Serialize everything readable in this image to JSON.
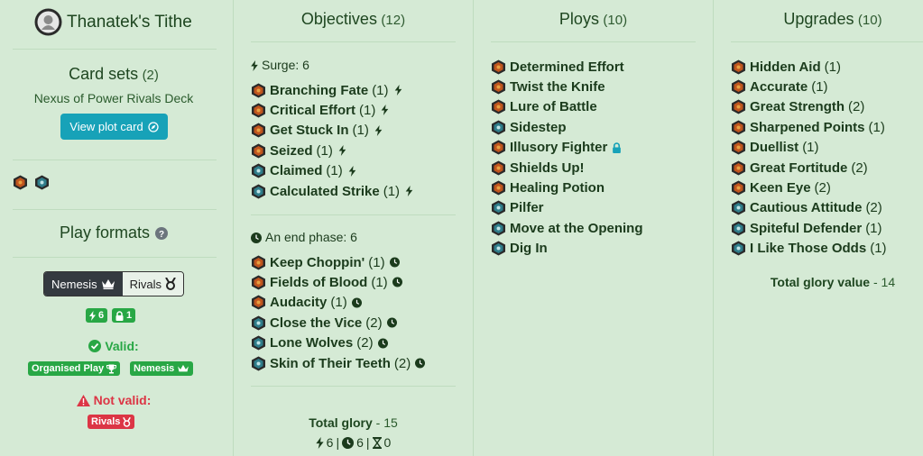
{
  "deck": {
    "title": "Thanatek's Tithe",
    "card_sets_label": "Card sets",
    "card_sets_count": "(2)",
    "card_set_name": "Nexus of Power Rivals Deck",
    "view_plot_label": "View plot card",
    "play_formats_label": "Play formats",
    "formats": {
      "nemesis": "Nemesis",
      "rivals": "Rivals",
      "selected": "Nemesis"
    },
    "stats": {
      "surge": "6",
      "locked": "1"
    },
    "valid_label": "Valid:",
    "valid_badges": [
      "Organised Play",
      "Nemesis"
    ],
    "not_valid_label": "Not valid:",
    "not_valid_badges": [
      "Rivals"
    ]
  },
  "objectives": {
    "title": "Objectives",
    "count": "(12)",
    "surge_label": "Surge: 6",
    "end_phase_label": "An end phase: 6",
    "surge_cards": [
      {
        "name": "Branching Fate",
        "qty": "(1)",
        "faction": "orange"
      },
      {
        "name": "Critical Effort",
        "qty": "(1)",
        "faction": "orange"
      },
      {
        "name": "Get Stuck In",
        "qty": "(1)",
        "faction": "orange"
      },
      {
        "name": "Seized",
        "qty": "(1)",
        "faction": "orange"
      },
      {
        "name": "Claimed",
        "qty": "(1)",
        "faction": "teal"
      },
      {
        "name": "Calculated Strike",
        "qty": "(1)",
        "faction": "teal"
      }
    ],
    "end_cards": [
      {
        "name": "Keep Choppin'",
        "qty": "(1)",
        "faction": "orange"
      },
      {
        "name": "Fields of Blood",
        "qty": "(1)",
        "faction": "orange"
      },
      {
        "name": "Audacity",
        "qty": "(1)",
        "faction": "orange"
      },
      {
        "name": "Close the Vice",
        "qty": "(2)",
        "faction": "teal"
      },
      {
        "name": "Lone Wolves",
        "qty": "(2)",
        "faction": "teal"
      },
      {
        "name": "Skin of Their Teeth",
        "qty": "(2)",
        "faction": "teal"
      }
    ],
    "total_label": "Total glory",
    "total_value": "- 15",
    "summary": {
      "surge": "6",
      "end": "6",
      "hourglass": "0"
    }
  },
  "ploys": {
    "title": "Ploys",
    "count": "(10)",
    "cards": [
      {
        "name": "Determined Effort",
        "faction": "orange",
        "locked": false
      },
      {
        "name": "Twist the Knife",
        "faction": "orange",
        "locked": false
      },
      {
        "name": "Lure of Battle",
        "faction": "orange",
        "locked": false
      },
      {
        "name": "Sidestep",
        "faction": "teal",
        "locked": false
      },
      {
        "name": "Illusory Fighter",
        "faction": "orange",
        "locked": true
      },
      {
        "name": "Shields Up!",
        "faction": "orange",
        "locked": false
      },
      {
        "name": "Healing Potion",
        "faction": "orange",
        "locked": false
      },
      {
        "name": "Pilfer",
        "faction": "teal",
        "locked": false
      },
      {
        "name": "Move at the Opening",
        "faction": "teal",
        "locked": false
      },
      {
        "name": "Dig In",
        "faction": "teal",
        "locked": false
      }
    ]
  },
  "upgrades": {
    "title": "Upgrades",
    "count": "(10)",
    "cards": [
      {
        "name": "Hidden Aid",
        "qty": "(1)",
        "faction": "orange"
      },
      {
        "name": "Accurate",
        "qty": "(1)",
        "faction": "orange"
      },
      {
        "name": "Great Strength",
        "qty": "(2)",
        "faction": "orange"
      },
      {
        "name": "Sharpened Points",
        "qty": "(1)",
        "faction": "orange"
      },
      {
        "name": "Duellist",
        "qty": "(1)",
        "faction": "orange"
      },
      {
        "name": "Great Fortitude",
        "qty": "(2)",
        "faction": "orange"
      },
      {
        "name": "Keen Eye",
        "qty": "(2)",
        "faction": "orange"
      },
      {
        "name": "Cautious Attitude",
        "qty": "(2)",
        "faction": "teal"
      },
      {
        "name": "Spiteful Defender",
        "qty": "(1)",
        "faction": "teal"
      },
      {
        "name": "I Like Those Odds",
        "qty": "(1)",
        "faction": "teal"
      }
    ],
    "total_label": "Total glory value",
    "total_value": "- 14"
  },
  "colors": {
    "background": "#d5ead5",
    "accent_info": "#17a2b8",
    "valid_green": "#28a745",
    "invalid_red": "#dc3545",
    "dark_toggle": "#343a40"
  },
  "icons": {
    "faction_orange": "orange-faction-hex-icon",
    "faction_teal": "teal-faction-hex-icon",
    "surge": "lightning-icon",
    "end_phase": "clock-icon",
    "locked": "lock-icon",
    "help": "question-circle-icon",
    "crown": "crown-icon",
    "rivals": "medal-icon",
    "trophy": "trophy-icon",
    "hourglass": "hourglass-icon",
    "check": "check-circle-icon",
    "warning": "warning-triangle-icon",
    "external": "compass-icon"
  }
}
